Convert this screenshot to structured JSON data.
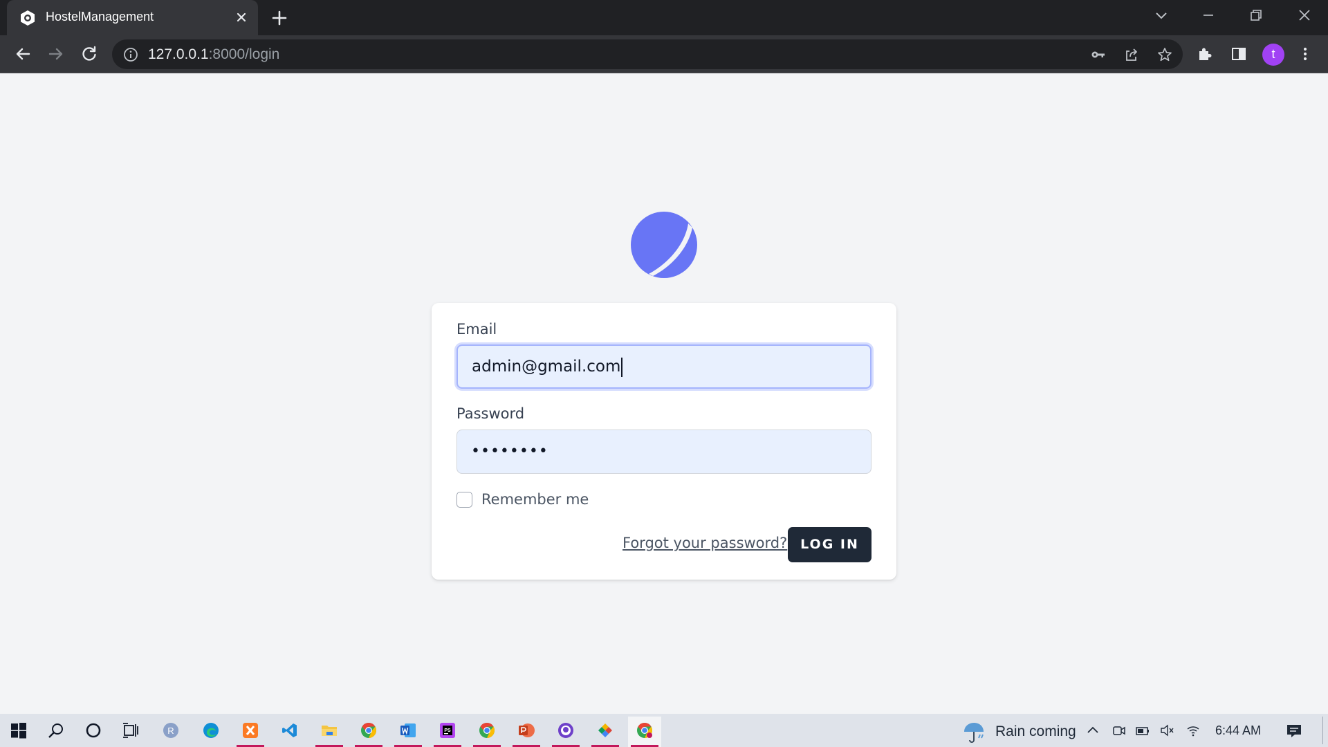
{
  "browser": {
    "tab_title": "HostelManagement",
    "url_host": "127.0.0.1",
    "url_rest": ":8000/login",
    "profile_initial": "t"
  },
  "login": {
    "email_label": "Email",
    "email_value": "admin@gmail.com",
    "password_label": "Password",
    "password_masked": "••••••••",
    "remember_label": "Remember me",
    "remember_checked": false,
    "forgot_link": "Forgot your password?",
    "login_button": "LOG IN",
    "brand_color": "#6875f5"
  },
  "taskbar": {
    "apps": [
      "start",
      "search",
      "cortana",
      "task-view",
      "r-app",
      "edge",
      "xampp",
      "vscode",
      "file-explorer",
      "chrome",
      "word",
      "phpstorm",
      "chrome",
      "powerpoint",
      "github-desktop",
      "git-app",
      "chrome"
    ],
    "weather_text": "Rain coming",
    "time": "6:44 AM"
  }
}
